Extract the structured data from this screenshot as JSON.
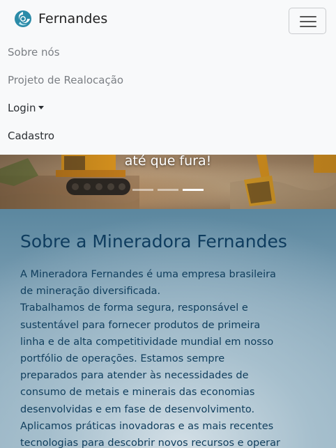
{
  "navbar": {
    "brand_name": "Fernandes",
    "brand_icon": "swirl-logo-icon",
    "toggler_icon": "hamburger-menu-icon",
    "links": [
      {
        "label": "Sobre nós"
      },
      {
        "label": "Projeto de Realocação"
      },
      {
        "label": "Login",
        "dropdown": true
      },
      {
        "label": "Cadastro"
      }
    ]
  },
  "hero": {
    "caption": "até que fura!",
    "slide_count": 3,
    "active_slide": 3
  },
  "about": {
    "title": "Sobre a Mineradora Fernandes",
    "paragraphs": [
      "A Mineradora Fernandes é uma empresa brasileira de mineração diversificada.",
      "Trabalhamos de forma segura, responsável e sustentável para fornecer produtos de primeira linha e de alta competitividade mundial em nosso portfólio de operações. Estamos sempre preparados para atender às necessidades de consumo de metais e minerais das economias desenvolvidas e em fase de desenvolvimento.",
      "Aplicamos práticas inovadoras e as mais recentes tecnologias para descobrir novos recursos e operar"
    ]
  },
  "colors": {
    "brand_teal": "#2a8aa6",
    "title_blue": "#0e3c5e",
    "navbar_bg": "#f8f9fa"
  }
}
